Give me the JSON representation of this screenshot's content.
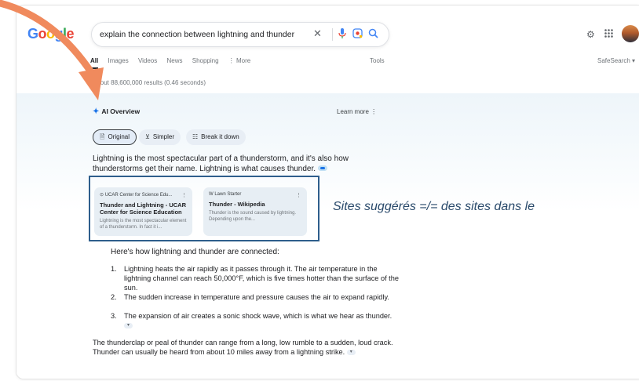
{
  "search": {
    "logo_letters": [
      "G",
      "o",
      "o",
      "g",
      "l",
      "e"
    ],
    "query": "explain the connection between lightning and thunder",
    "clear_icon": "close-icon",
    "mic_icon": "microphone-icon",
    "lens_icon": "lens-icon",
    "search_icon": "search-icon"
  },
  "header_icons": {
    "settings": "gear-icon",
    "apps": "apps-grid-icon",
    "avatar": "avatar"
  },
  "tabs": [
    {
      "label": "All"
    },
    {
      "label": "Images"
    },
    {
      "label": "Videos"
    },
    {
      "label": "News"
    },
    {
      "label": "Shopping"
    },
    {
      "label": "⋮ More"
    }
  ],
  "tools_label": "Tools",
  "safesearch_label": "SafeSearch ▾",
  "result_stats": "About 88,600,000 results (0.46 seconds)",
  "ai_overview": {
    "title": "AI Overview",
    "learn_more": "Learn more ⋮",
    "chips": [
      {
        "icon": "🗎",
        "label": "Original"
      },
      {
        "icon": "⊻",
        "label": "Simpler"
      },
      {
        "icon": "☷",
        "label": "Break it down"
      }
    ],
    "intro": "Lightning is the most spectacular part of a thunderstorm, and it's also how thunderstorms get their name. Lightning is what causes thunder.",
    "sources": [
      {
        "site": "UCAR Center for Science Edu...",
        "title": "Thunder and Lightning - UCAR Center for Science Education",
        "desc": "Lightning is the most spectacular element of a thunderstorm. In fact it i..."
      },
      {
        "site": "W Lawn Starter",
        "title": "Thunder - Wikipedia",
        "desc": "Thunder is the sound caused by lightning. Depending upon the..."
      }
    ],
    "how_heading": "Here's how lightning and thunder are connected:",
    "steps": [
      "Lightning heats the air rapidly as it passes through it. The air temperature in the lightning channel can reach 50,000°F, which is five times hotter than the surface of the sun.",
      "The sudden increase in temperature and pressure causes the air to expand rapidly.",
      "The expansion of air creates a sonic shock wave, which is what we hear as thunder."
    ],
    "closing": "The thunderclap or peal of thunder can range from a long, low rumble to a sudden, loud crack. Thunder can usually be heard from about 10 miles away from a lightning strike."
  },
  "annotation": "Sites suggérés =/= des sites dans le",
  "colors": {
    "arrow": "#f08a5d",
    "highlight_box": "#2e5e8c",
    "annotation_text": "#2a4a6b"
  }
}
